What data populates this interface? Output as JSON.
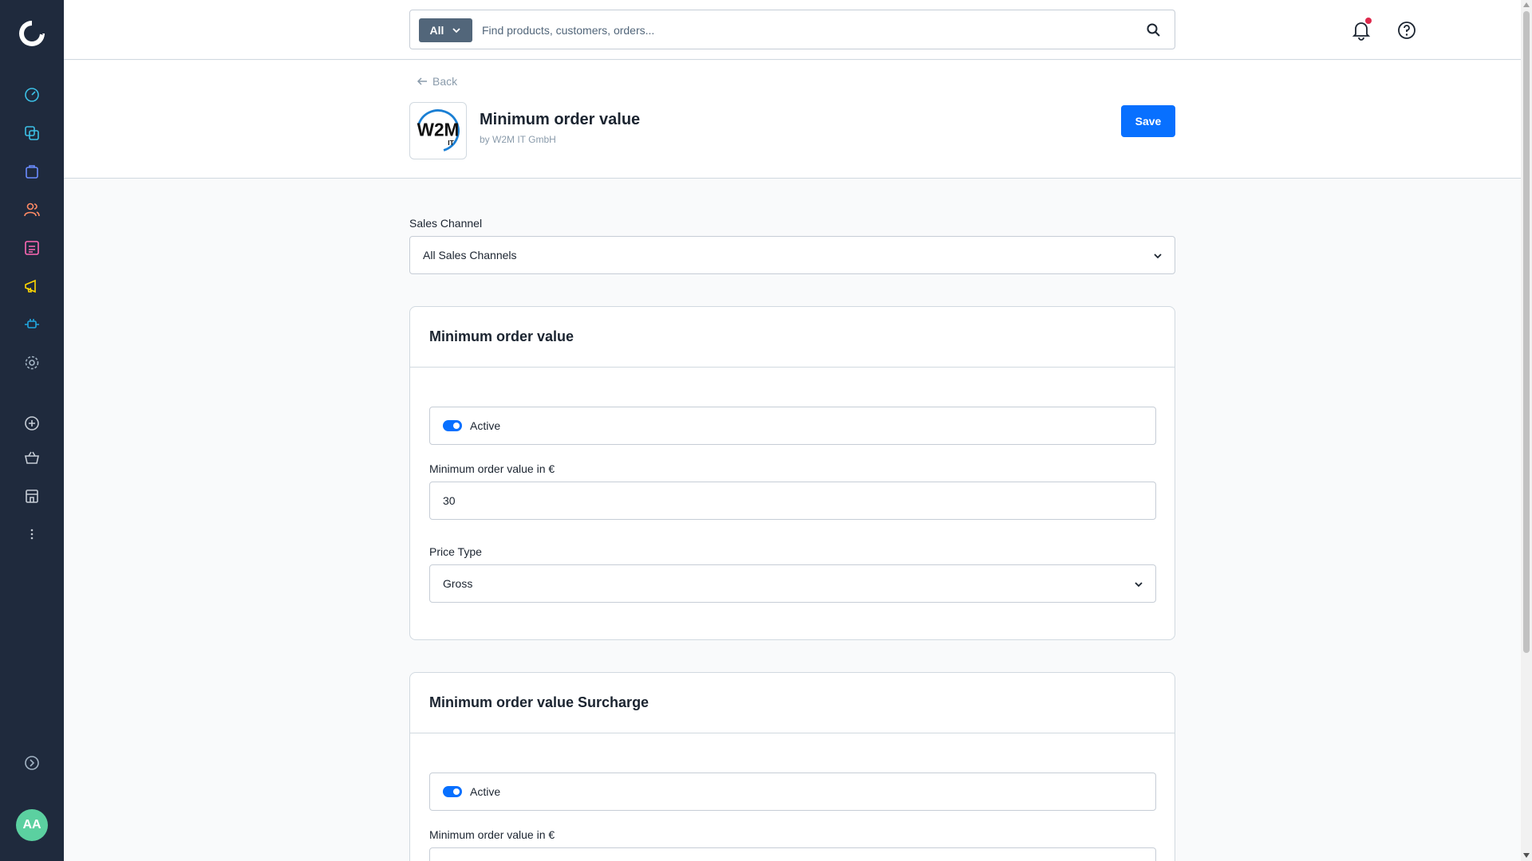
{
  "sidebar": {
    "items": [
      {
        "name": "dashboard",
        "color": "#3cc0e6"
      },
      {
        "name": "catalogues",
        "color": "#3cc0e6"
      },
      {
        "name": "orders",
        "color": "#6b8cff"
      },
      {
        "name": "customers",
        "color": "#ff8a65"
      },
      {
        "name": "content",
        "color": "#ff68b4"
      },
      {
        "name": "marketing",
        "color": "#ffd700"
      },
      {
        "name": "extensions",
        "color": "#21a7e0"
      },
      {
        "name": "settings",
        "color": "#a3b4c4"
      }
    ],
    "avatar_initials": "AA"
  },
  "search": {
    "type_label": "All",
    "placeholder": "Find products, customers, orders..."
  },
  "header": {
    "back_label": "Back",
    "logo_text": "W2M",
    "logo_sub": "IT",
    "title": "Minimum order value",
    "author": "by W2M IT GmbH",
    "save_label": "Save"
  },
  "sales_channel": {
    "label": "Sales Channel",
    "value": "All Sales Channels"
  },
  "card1": {
    "title": "Minimum order value",
    "active_label": "Active",
    "min_value_label": "Minimum order value in €",
    "min_value": "30",
    "price_type_label": "Price Type",
    "price_type_value": "Gross"
  },
  "card2": {
    "title": "Minimum order value Surcharge",
    "active_label": "Active",
    "min_value_label": "Minimum order value in €"
  },
  "colors": {
    "sidebar_bg": "#1f2a3d",
    "primary": "#0870ff",
    "notification_dot": "#de294c"
  }
}
